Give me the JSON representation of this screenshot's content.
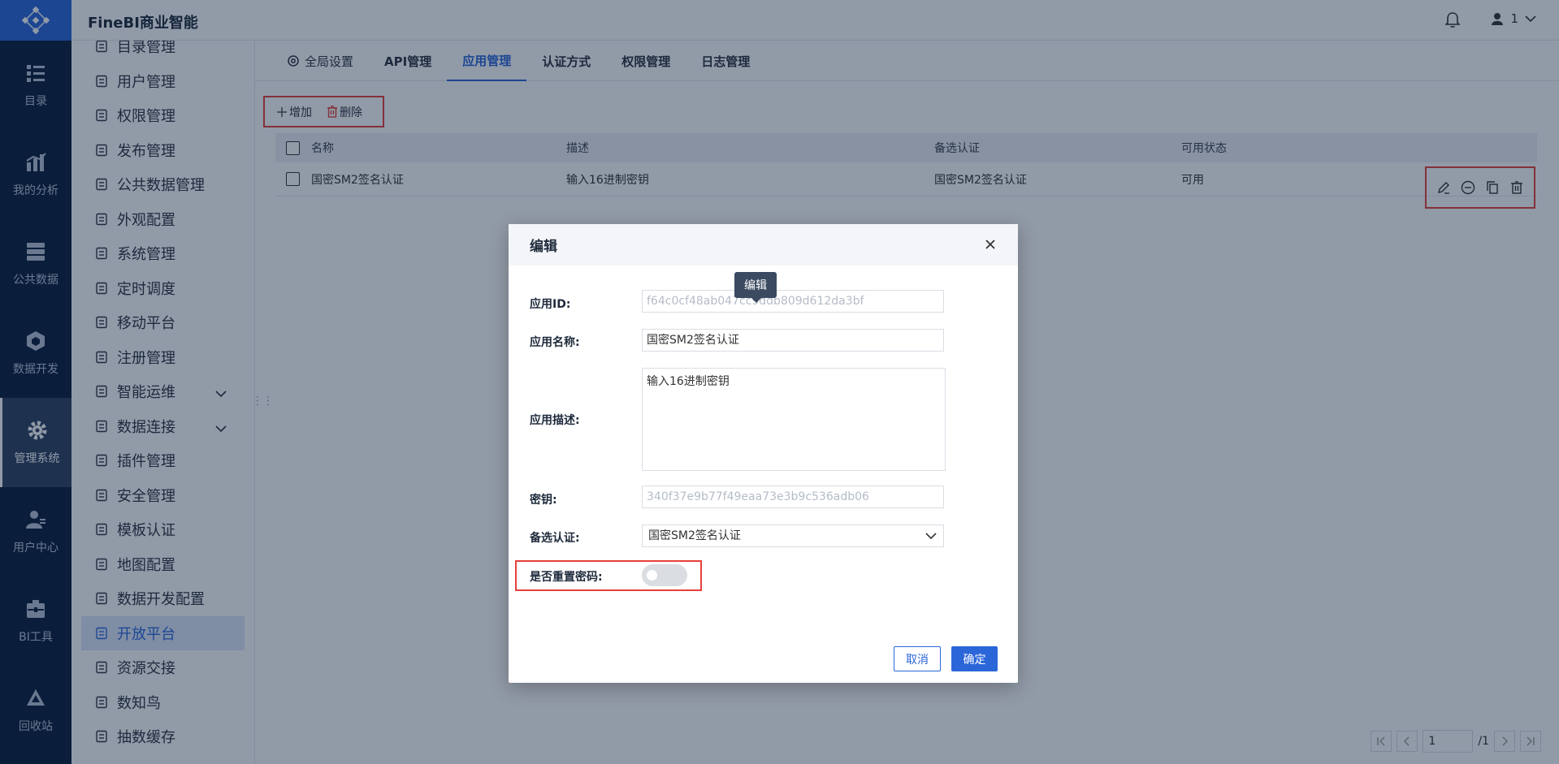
{
  "app": {
    "title": "FineBI商业智能",
    "user_name": "1"
  },
  "rail": {
    "items": [
      {
        "label": "目录",
        "icon": "catalog-icon"
      },
      {
        "label": "我的分析",
        "icon": "analysis-icon"
      },
      {
        "label": "公共数据",
        "icon": "public-data-icon"
      },
      {
        "label": "数据开发",
        "icon": "data-dev-icon"
      },
      {
        "label": "管理系统",
        "icon": "gear-icon",
        "active": true
      },
      {
        "label": "用户中心",
        "icon": "user-center-icon"
      },
      {
        "label": "BI工具",
        "icon": "toolbox-icon"
      },
      {
        "label": "回收站",
        "icon": "recycle-icon"
      }
    ]
  },
  "sidebar": {
    "items": [
      {
        "label": "目录管理"
      },
      {
        "label": "用户管理"
      },
      {
        "label": "权限管理"
      },
      {
        "label": "发布管理"
      },
      {
        "label": "公共数据管理"
      },
      {
        "label": "外观配置"
      },
      {
        "label": "系统管理"
      },
      {
        "label": "定时调度"
      },
      {
        "label": "移动平台"
      },
      {
        "label": "注册管理"
      },
      {
        "label": "智能运维"
      },
      {
        "label": "数据连接"
      },
      {
        "label": "插件管理"
      },
      {
        "label": "安全管理"
      },
      {
        "label": "模板认证"
      },
      {
        "label": "地图配置"
      },
      {
        "label": "数据开发配置"
      },
      {
        "label": "开放平台"
      },
      {
        "label": "资源交接"
      },
      {
        "label": "数知鸟"
      },
      {
        "label": "抽数缓存"
      }
    ]
  },
  "tabs": [
    {
      "label": "全局设置"
    },
    {
      "label": "API管理"
    },
    {
      "label": "应用管理"
    },
    {
      "label": "认证方式"
    },
    {
      "label": "权限管理"
    },
    {
      "label": "日志管理"
    }
  ],
  "toolbar": {
    "add_label": "增加",
    "delete_label": "删除"
  },
  "table": {
    "headers": {
      "name": "名称",
      "desc": "描述",
      "alt": "备选认证",
      "status": "可用状态"
    },
    "rows": [
      {
        "name": "国密SM2签名认证",
        "desc": "输入16进制密钥",
        "alt": "国密SM2签名认证",
        "status": "可用"
      }
    ]
  },
  "pager": {
    "page": "1",
    "total": "/1"
  },
  "dialog": {
    "title": "编辑",
    "tooltip": "编辑",
    "app_id_label": "应用ID:",
    "app_id_value": "f64c0cf48ab047cc9ddb809d612da3bf",
    "app_name_label": "应用名称:",
    "app_name_value": "国密SM2签名认证",
    "app_desc_label": "应用描述:",
    "app_desc_value": "输入16进制密钥",
    "secret_label": "密钥:",
    "secret_value": "340f37e9b77f49eaa73e3b9c536adb06",
    "alt_auth_label": "备选认证:",
    "alt_auth_value": "国密SM2签名认证",
    "reset_label": "是否重置密码:",
    "cancel_label": "取消",
    "ok_label": "确定"
  },
  "colors": {
    "accent": "#2b66d9",
    "rail_bg": "#0a1e3c",
    "highlight": "#e8403a"
  }
}
